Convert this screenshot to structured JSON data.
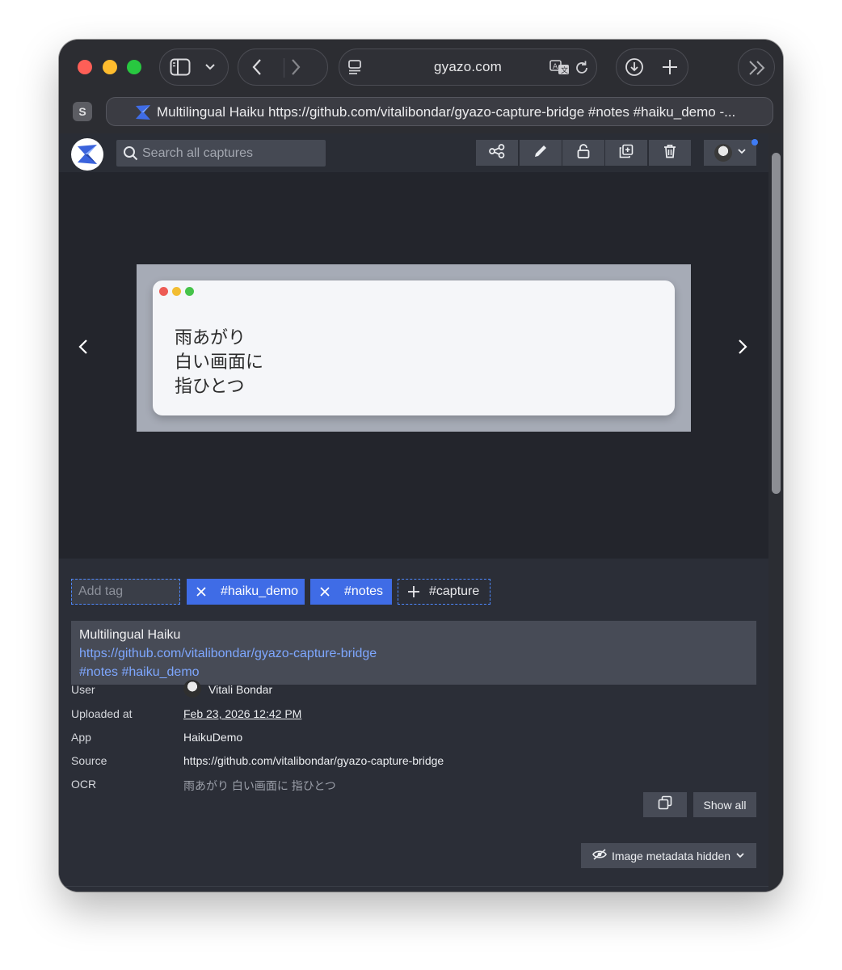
{
  "browser": {
    "url": "gyazo.com",
    "profile_initial": "S",
    "tab_title": "Multilingual Haiku https://github.com/vitalibondar/gyazo-capture-bridge #notes #haiku_demo -..."
  },
  "app": {
    "search_placeholder": "Search all captures",
    "toolbar": [
      "share-icon",
      "pencil-icon",
      "lock-icon",
      "duplicate-icon",
      "trash-icon"
    ]
  },
  "capture": {
    "poem": [
      "雨あがり",
      "白い画面に",
      "指ひとつ"
    ]
  },
  "tags": {
    "add_placeholder": "Add tag",
    "applied": [
      "#haiku_demo",
      "#notes"
    ],
    "suggested": "#capture",
    "accent": "#3f6ce6"
  },
  "description": {
    "title": "Multilingual Haiku",
    "link": "https://github.com/vitalibondar/gyazo-capture-bridge",
    "tags_line": "#notes #haiku_demo"
  },
  "meta": {
    "user_label": "User",
    "user_value": "Vitali Bondar",
    "uploaded_label": "Uploaded at",
    "uploaded_value": "Feb 23, 2026 12:42 PM",
    "app_label": "App",
    "app_value": "HaikuDemo",
    "source_label": "Source",
    "source_value": "https://github.com/vitalibondar/gyazo-capture-bridge",
    "ocr_label": "OCR",
    "ocr_value": "雨あがり 白い画面に 指ひとつ",
    "show_all": "Show all",
    "metadata_toggle": "Image metadata hidden"
  }
}
